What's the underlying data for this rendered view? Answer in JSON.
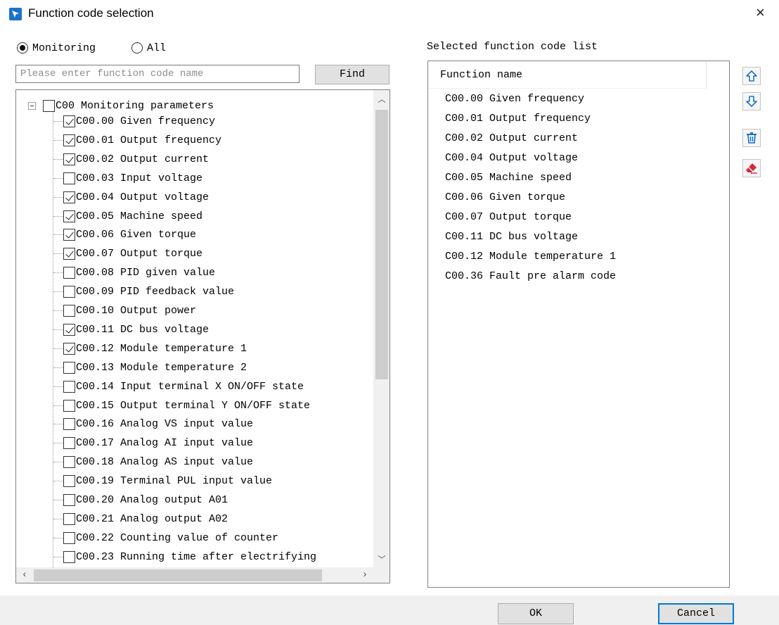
{
  "window": {
    "title": "Function code selection",
    "close_glyph": "×"
  },
  "filter": {
    "options": [
      {
        "label": "Monitoring",
        "selected": true
      },
      {
        "label": "All",
        "selected": false
      }
    ]
  },
  "search": {
    "placeholder": "Please enter function code name",
    "value": "",
    "find_label": "Find"
  },
  "tree": {
    "root": {
      "label": "C00 Monitoring parameters",
      "checked": false,
      "expanded": true
    },
    "items": [
      {
        "label": "C00.00 Given frequency",
        "checked": true
      },
      {
        "label": "C00.01 Output frequency",
        "checked": true
      },
      {
        "label": "C00.02 Output current",
        "checked": true
      },
      {
        "label": "C00.03 Input voltage",
        "checked": false
      },
      {
        "label": "C00.04 Output voltage",
        "checked": true
      },
      {
        "label": "C00.05 Machine speed",
        "checked": true
      },
      {
        "label": "C00.06 Given torque",
        "checked": true
      },
      {
        "label": "C00.07 Output torque",
        "checked": true
      },
      {
        "label": "C00.08 PID given value",
        "checked": false
      },
      {
        "label": "C00.09 PID feedback value",
        "checked": false
      },
      {
        "label": "C00.10 Output power",
        "checked": false
      },
      {
        "label": "C00.11 DC bus voltage",
        "checked": true
      },
      {
        "label": "C00.12 Module temperature 1",
        "checked": true
      },
      {
        "label": "C00.13 Module temperature 2",
        "checked": false
      },
      {
        "label": "C00.14 Input terminal X ON/OFF state",
        "checked": false
      },
      {
        "label": "C00.15 Output terminal Y ON/OFF state",
        "checked": false
      },
      {
        "label": "C00.16 Analog VS input value",
        "checked": false
      },
      {
        "label": "C00.17 Analog AI input value",
        "checked": false
      },
      {
        "label": "C00.18 Analog AS input value",
        "checked": false
      },
      {
        "label": "C00.19 Terminal PUL input value",
        "checked": false
      },
      {
        "label": "C00.20 Analog output A01",
        "checked": false
      },
      {
        "label": "C00.21 Analog output A02",
        "checked": false
      },
      {
        "label": "C00.22 Counting value of counter",
        "checked": false
      },
      {
        "label": "C00.23 Running time after electrifying",
        "checked": false
      }
    ]
  },
  "selected_list": {
    "title": "Selected function code list",
    "column_header": "Function name",
    "items": [
      "C00.00 Given frequency",
      "C00.01 Output frequency",
      "C00.02 Output current",
      "C00.04 Output voltage",
      "C00.05 Machine speed",
      "C00.06 Given torque",
      "C00.07 Output torque",
      "C00.11 DC bus voltage",
      "C00.12 Module temperature 1",
      "C00.36 Fault pre alarm code"
    ]
  },
  "side_buttons": [
    {
      "icon": "arrow-up-icon"
    },
    {
      "icon": "arrow-down-icon"
    },
    {
      "icon": "trash-icon"
    },
    {
      "icon": "eraser-icon"
    }
  ],
  "footer": {
    "ok_label": "OK",
    "cancel_label": "Cancel"
  },
  "colors": {
    "accent": "#0078d7",
    "icon_blue": "#1a73c9",
    "icon_red": "#d9263a"
  }
}
